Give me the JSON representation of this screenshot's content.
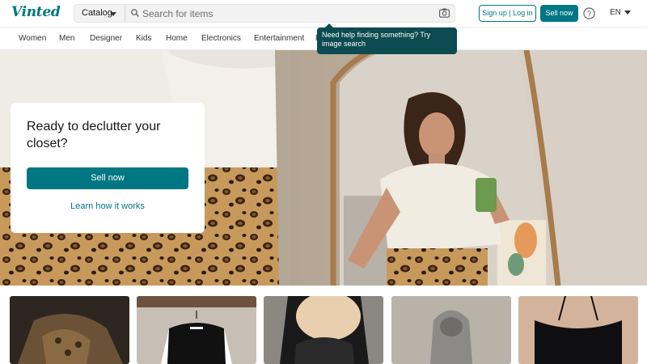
{
  "header": {
    "logo": "Vinted",
    "catalog_label": "Catalog",
    "search_placeholder": "Search for items",
    "signup_label": "Sign up | Log in",
    "sell_label": "Sell now",
    "lang_label": "EN"
  },
  "nav": {
    "categories": [
      "Women",
      "Men",
      "Designer",
      "Kids",
      "Home",
      "Electronics",
      "Entertainment",
      "P"
    ]
  },
  "tooltip": {
    "text": "Need help finding something? Try image search"
  },
  "hero": {
    "title": "Ready to declutter your closet?",
    "cta_label": "Sell now",
    "link_label": "Learn how it works"
  },
  "colors": {
    "brand": "#007782",
    "tooltip_bg": "#0b4b51"
  },
  "icons": [
    "search-icon",
    "camera-icon",
    "help-icon",
    "chevron-down-icon"
  ]
}
